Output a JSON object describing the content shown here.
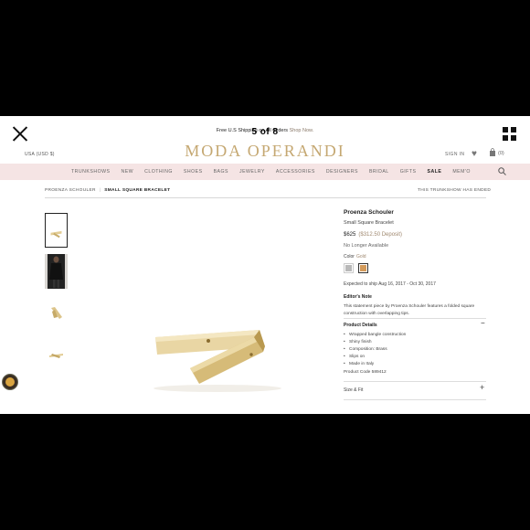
{
  "viewer": {
    "counter": "5 of 8"
  },
  "promo": {
    "text": "Free U.S Shipping on All Orders",
    "link": "Shop Now."
  },
  "header": {
    "currency": "USA (USD $)",
    "logo": "MODA OPERANDI",
    "sign_in": "SIGN IN",
    "bag_count": "(0)"
  },
  "nav": {
    "items": [
      "TRUNKSHOWS",
      "NEW",
      "CLOTHING",
      "SHOES",
      "BAGS",
      "JEWELRY",
      "ACCESSORIES",
      "DESIGNERS",
      "BRIDAL",
      "GIFTS",
      "SALE",
      "MEM'O"
    ]
  },
  "breadcrumb": {
    "brand": "PROENZA SCHOULER",
    "current": "SMALL SQUARE BRACELET",
    "status": "THIS TRUNKSHOW HAS ENDED"
  },
  "product": {
    "brand": "Proenza Schouler",
    "name": "Small Square Bracelet",
    "price": "$625",
    "deposit": "($312.50 Deposit)",
    "availability": "No Longer Available",
    "color_label": "Color",
    "color_value": "Gold",
    "swatch_colors": [
      "#b9b9b9",
      "#d39a5a"
    ],
    "ship": "Expected to ship Aug 16, 2017 - Oct 30, 2017",
    "editors_note_title": "Editor's Note",
    "editors_note": "This statement piece by Proenza Schouler features a folded square construction with overlapping tips.",
    "details_title": "Product Details",
    "details_toggle": "−",
    "details": [
      "Wrapped bangle construction",
      "Shiny finish",
      "Composition: Brass",
      "Slips on",
      "Made in Italy"
    ],
    "product_code": "Product Code 589412",
    "size_fit": "Size & Fit",
    "size_toggle": "+"
  },
  "icons": [
    "close-icon",
    "grid-icon",
    "heart-icon",
    "bag-icon",
    "search-icon",
    "chat-icon"
  ]
}
